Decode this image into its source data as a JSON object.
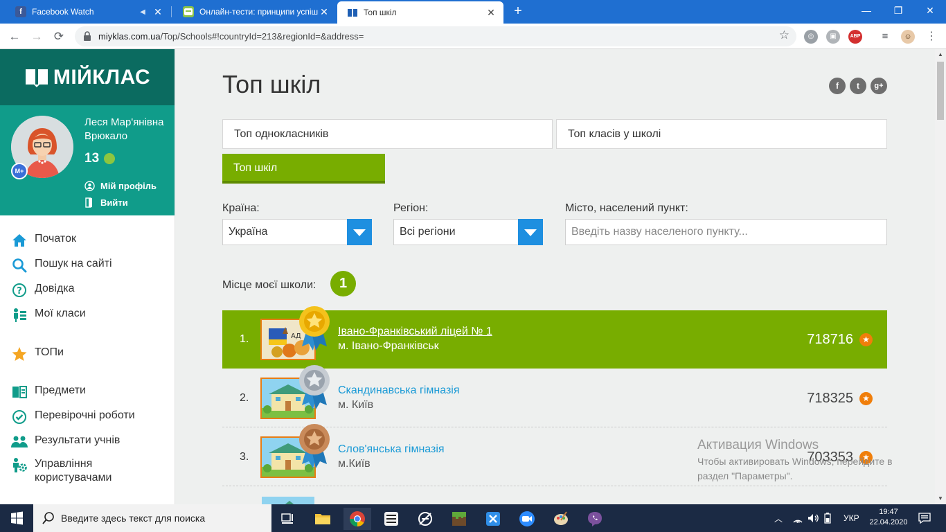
{
  "browser": {
    "tabs": [
      {
        "title": "Facebook Watch",
        "icon": "facebook-icon",
        "active": false
      },
      {
        "title": "Онлайн-тести: принципи успішн",
        "icon": "test-icon",
        "active": false
      },
      {
        "title": "Топ шкіл",
        "icon": "book-icon",
        "active": true
      }
    ],
    "url_host": "miyklas.com.ua",
    "url_path": "/Top/Schools#!countryId=213&regionId=&address="
  },
  "sidebar": {
    "logo": "МІЙКЛАС",
    "user_name": "Леся Мар'янівна Врюкало",
    "coins": "13",
    "badge": "М+",
    "profile_link": "Мій профіль",
    "logout_link": "Вийти",
    "menu": [
      {
        "label": "Початок",
        "icon": "home-icon",
        "color": "#1a9ad6"
      },
      {
        "label": "Пошук на сайті",
        "icon": "search-icon",
        "color": "#1a9ad6"
      },
      {
        "label": "Довідка",
        "icon": "help-icon",
        "color": "#109c8a"
      },
      {
        "label": "Мої класи",
        "icon": "classes-icon",
        "color": "#109c8a"
      },
      {
        "label": "ТОПи",
        "icon": "star-icon",
        "color": "#f5a623"
      },
      {
        "label": "Предмети",
        "icon": "subjects-icon",
        "color": "#109c8a"
      },
      {
        "label": "Перевірочні роботи",
        "icon": "check-icon",
        "color": "#109c8a"
      },
      {
        "label": "Результати учнів",
        "icon": "students-icon",
        "color": "#109c8a"
      },
      {
        "label": "Управління користувачами",
        "icon": "users-gear-icon",
        "color": "#109c8a"
      }
    ]
  },
  "main": {
    "title": "Топ шкіл",
    "tabs": [
      "Топ однокласників",
      "Топ класів у школі",
      "Топ шкіл"
    ],
    "filters": {
      "country_label": "Країна:",
      "country_value": "Україна",
      "region_label": "Регіон:",
      "region_value": "Всі регіони",
      "city_label": "Місто, населений пункт:",
      "city_placeholder": "Введіть назву населеного пункту..."
    },
    "my_place_label": "Місце моєї школи:",
    "my_place_value": "1",
    "schools": [
      {
        "rank": "1.",
        "name": "Івано-Франківський ліцей № 1",
        "city": "м. Івано-Франківськ",
        "score": "718716",
        "medal": "gold"
      },
      {
        "rank": "2.",
        "name": "Скандинавська гімназія",
        "city": "м. Київ",
        "score": "718325",
        "medal": "silver"
      },
      {
        "rank": "3.",
        "name": "Слов'янська гімназія",
        "city": "м.Київ",
        "score": "703353",
        "medal": "bronze"
      }
    ],
    "colors": {
      "accent_green": "#78ad00",
      "teal": "#109c8a",
      "link_blue": "#1a9ad6",
      "score_star": "#f07e0a"
    }
  },
  "watermark": {
    "line1": "Активация Windows",
    "line2": "Чтобы активировать Windows, перейдите в",
    "line3": "раздел \"Параметры\"."
  },
  "taskbar": {
    "search_placeholder": "Введите здесь текст для поиска",
    "language": "УКР",
    "time": "19:47",
    "date": "22.04.2020"
  }
}
